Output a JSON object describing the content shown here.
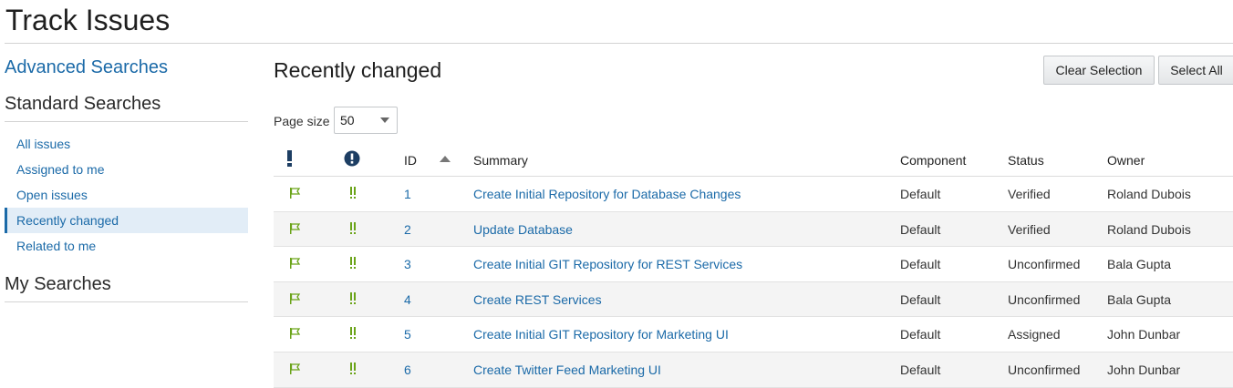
{
  "page": {
    "title": "Track Issues"
  },
  "sidebar": {
    "advanced_link": "Advanced Searches",
    "standard_heading": "Standard Searches",
    "standard_items": [
      {
        "label": "All issues"
      },
      {
        "label": "Assigned to me"
      },
      {
        "label": "Open issues"
      },
      {
        "label": "Recently changed",
        "active": true
      },
      {
        "label": "Related to me"
      }
    ],
    "my_heading": "My Searches"
  },
  "main": {
    "title": "Recently changed",
    "buttons": {
      "clear_selection": "Clear Selection",
      "select_all": "Select All"
    },
    "page_size": {
      "label": "Page size",
      "value": "50"
    },
    "table": {
      "header_icons": {
        "priority": "exclamation-bar-icon",
        "severity": "exclamation-circle-icon"
      },
      "sort_column": "ID",
      "sort_direction": "ascending",
      "columns": {
        "id": "ID",
        "summary": "Summary",
        "component": "Component",
        "status": "Status",
        "owner": "Owner"
      },
      "rows": [
        {
          "id": "1",
          "summary": "Create Initial Repository for Database Changes",
          "component": "Default",
          "status": "Verified",
          "owner": "Roland Dubois"
        },
        {
          "id": "2",
          "summary": "Update Database",
          "component": "Default",
          "status": "Verified",
          "owner": "Roland Dubois"
        },
        {
          "id": "3",
          "summary": "Create Initial GIT Repository for REST Services",
          "component": "Default",
          "status": "Unconfirmed",
          "owner": "Bala Gupta"
        },
        {
          "id": "4",
          "summary": "Create REST Services",
          "component": "Default",
          "status": "Unconfirmed",
          "owner": "Bala Gupta"
        },
        {
          "id": "5",
          "summary": "Create Initial GIT Repository for Marketing UI",
          "component": "Default",
          "status": "Assigned",
          "owner": "John Dunbar"
        },
        {
          "id": "6",
          "summary": "Create Twitter Feed Marketing UI",
          "component": "Default",
          "status": "Unconfirmed",
          "owner": "John Dunbar"
        }
      ]
    }
  },
  "colors": {
    "link": "#1b6aa8",
    "active_bg": "#e2edf7",
    "priority_green": "#6aa318",
    "header_icon": "#1d3e63"
  }
}
